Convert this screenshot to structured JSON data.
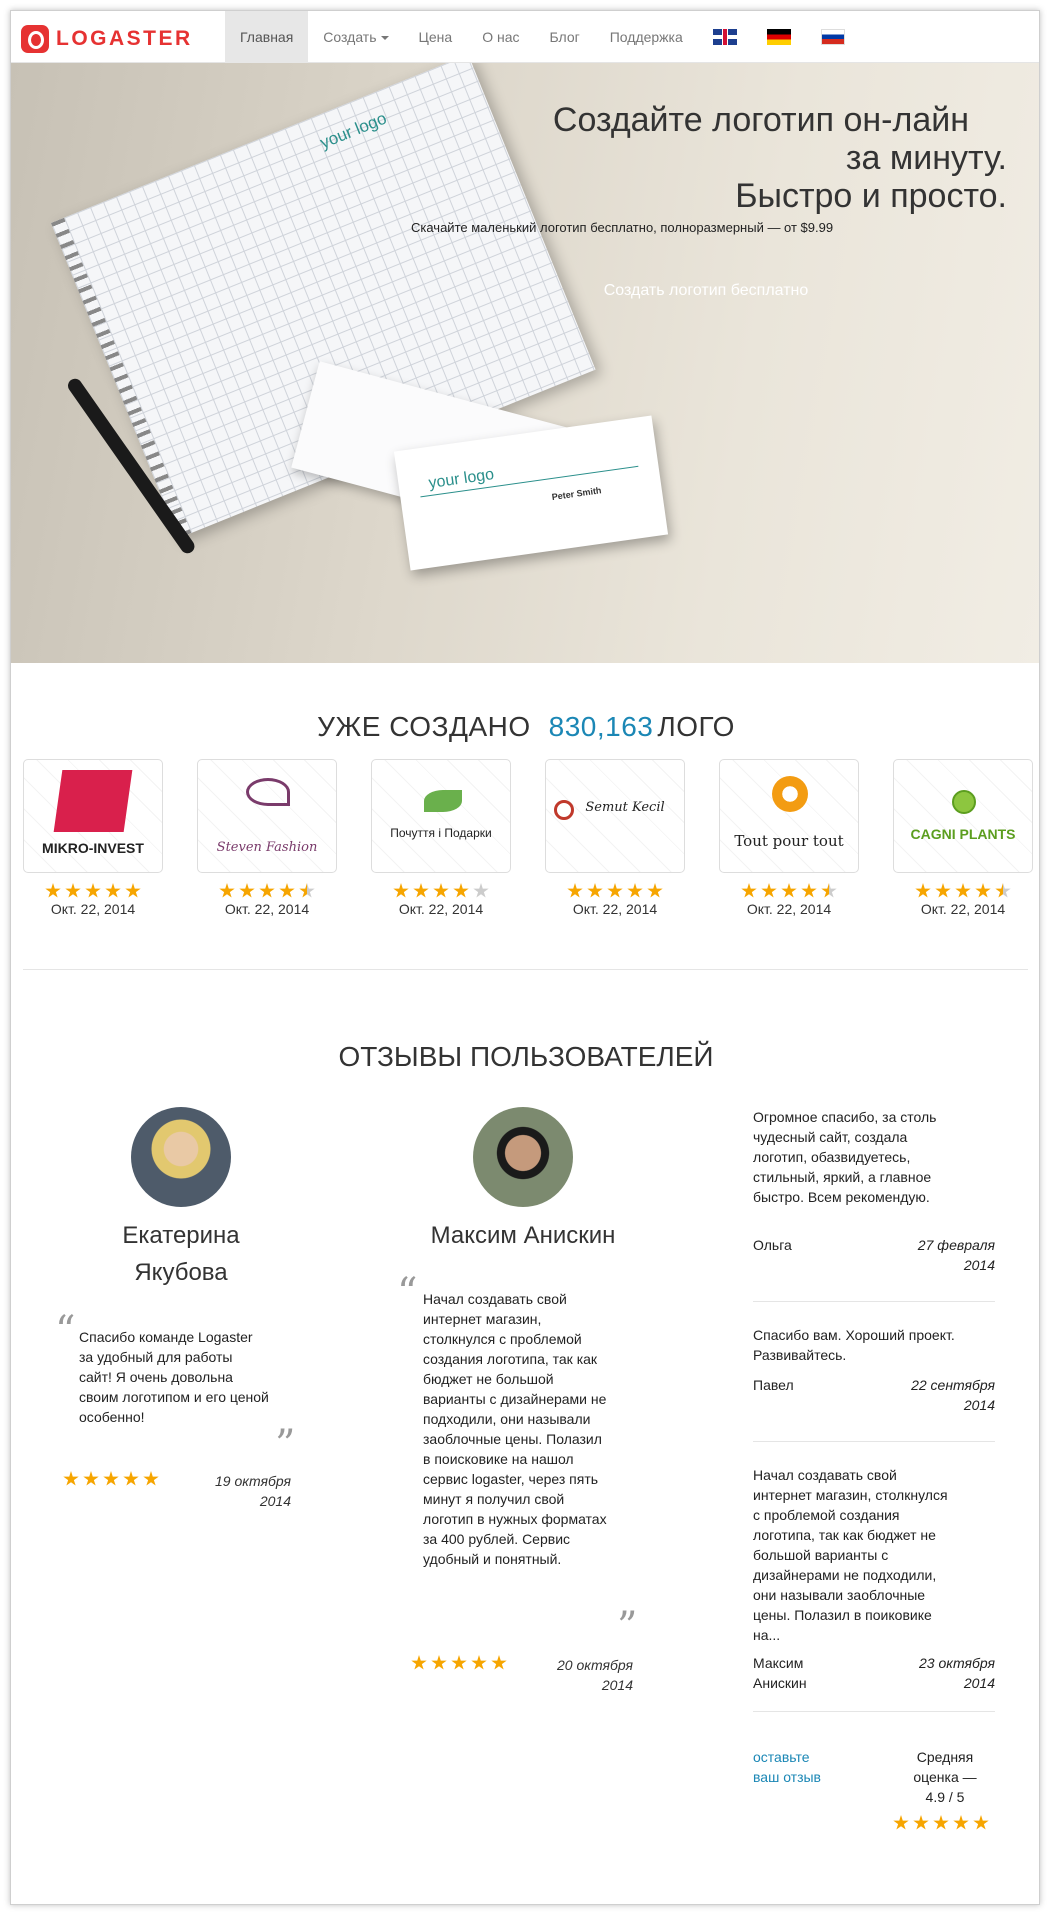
{
  "nav": {
    "logo_text": "LOGASTER",
    "items": [
      {
        "label": "Главная",
        "active": true
      },
      {
        "label": "Создать",
        "dropdown": true
      },
      {
        "label": "Цена"
      },
      {
        "label": "О нас"
      },
      {
        "label": "Блог"
      },
      {
        "label": "Поддержка"
      }
    ],
    "flags": [
      "flag-uk-icon",
      "flag-de-icon",
      "flag-ru-icon"
    ]
  },
  "hero": {
    "title_line1": "Создайте логотип он-лайн",
    "title_line2": "за минуту.",
    "title_line3": "Быстро и просто.",
    "subtitle": "Скачайте маленький логотип бесплатно, полноразмерный — от $9.99",
    "cta": "Создать логотип бесплатно",
    "notebook_logo": "your logo",
    "card_logo": "your logo",
    "card_name": "Peter Smith"
  },
  "created": {
    "prefix": "УЖЕ СОЗДАНО",
    "count": "830,163",
    "suffix": "ЛОГО"
  },
  "logos": [
    {
      "name": "MIKRO-INVEST",
      "rating": 5,
      "date": "Окт. 22, 2014",
      "color": "#d9204c"
    },
    {
      "name": "Steven Fashion",
      "rating": 4.5,
      "date": "Окт. 22, 2014",
      "color": "#7a3b6b"
    },
    {
      "name": "Почуття і Подарки",
      "rating": 4,
      "date": "Окт. 22, 2014",
      "color": "#4d8f3a"
    },
    {
      "name": "Semut Kecil",
      "rating": 5,
      "date": "Окт. 22, 2014",
      "color": "#c0392b"
    },
    {
      "name": "Tout pour tout",
      "rating": 4.5,
      "date": "Окт. 22, 2014",
      "color": "#f39c12"
    },
    {
      "name": "CAGNI PLANTS",
      "rating": 4.5,
      "date": "Окт. 22, 2014",
      "color": "#5c9e1f"
    }
  ],
  "reviews": {
    "title": "ОТЗЫВЫ ПОЛЬЗОВАТЕЛЕЙ",
    "main": [
      {
        "name_line1": "Екатерина",
        "name_line2": "Якубова",
        "text": "Спасибо команде Logaster за удобный для работы сайт! Я очень довольна своим логотипом и его ценой особенно!",
        "date_line1": "19 октября",
        "date_line2": "2014",
        "rating": 5
      },
      {
        "name_line1": "Максим Анискин",
        "text": "Начал создавать свой интернет магазин, столкнулся с проблемой создания логотипа, так как бюджет не большой варианты с дизайнерами не подходили, они называли заоблочные цены. Полазил в поисковике на нашол сервис logaster, через пять минут я получил свой логотип в нужных форматах за 400 рублей. Сервис удобный и понятный.",
        "date_line1": "20 октября",
        "date_line2": "2014",
        "rating": 5
      }
    ],
    "side": [
      {
        "text": "Огромное спасибо, за столь чудесный сайт, создала логотип, обазвидуетесь, стильный, яркий, а главное быстро. Всем рекомендую.",
        "name": "Ольга",
        "date_line1": "27 февраля",
        "date_line2": "2014"
      },
      {
        "text": "Спасибо вам. Хороший проект. Развивайтесь.",
        "name": "Павел",
        "date_line1": "22 сентября",
        "date_line2": "2014"
      },
      {
        "text": "Начал создавать свой интернет магазин, столкнулся с проблемой создания логотипа, так как бюджет не большой варианты с дизайнерами не подходили, они называли заоблочные цены. Полазил в поиковике на...",
        "name_line1": "Максим",
        "name_line2": "Анискин",
        "date_line1": "23 октября",
        "date_line2": "2014"
      }
    ],
    "leave_link_line1": "оставьте",
    "leave_link_line2": "ваш отзыв",
    "avg_line1": "Средняя",
    "avg_line2": "оценка —",
    "avg_line3": "4.9 / 5",
    "avg_rating": 5
  },
  "colors": {
    "accent": "#1b87b5",
    "brand": "#e63232",
    "star": "#f6a500"
  }
}
